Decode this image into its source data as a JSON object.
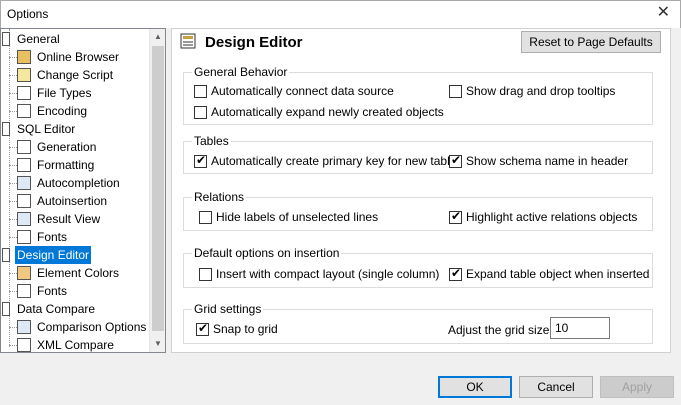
{
  "window": {
    "title": "Options",
    "close_glyph": "✕"
  },
  "tree": {
    "items": [
      {
        "label": "General",
        "icon": "section-icon",
        "level": 0
      },
      {
        "label": "Online Browser",
        "icon": "browser-icon",
        "level": 1
      },
      {
        "label": "Change Script",
        "icon": "script-icon",
        "level": 1
      },
      {
        "label": "File Types",
        "icon": "file-icon",
        "level": 1
      },
      {
        "label": "Encoding",
        "icon": "file-icon",
        "level": 1
      },
      {
        "label": "SQL Editor",
        "icon": "section-icon",
        "level": 0
      },
      {
        "label": "Generation",
        "icon": "gear-icon",
        "level": 1
      },
      {
        "label": "Formatting",
        "icon": "format-icon",
        "level": 1
      },
      {
        "label": "Autocompletion",
        "icon": "list-icon",
        "level": 1
      },
      {
        "label": "Autoinsertion",
        "icon": "insert-icon",
        "level": 1
      },
      {
        "label": "Result View",
        "icon": "grid-icon",
        "level": 1
      },
      {
        "label": "Fonts",
        "icon": "file-icon",
        "level": 1
      },
      {
        "label": "Design Editor",
        "icon": "section-icon",
        "level": 0,
        "selected": true
      },
      {
        "label": "Element Colors",
        "icon": "palette-icon",
        "level": 1
      },
      {
        "label": "Fonts",
        "icon": "file-icon",
        "level": 1
      },
      {
        "label": "Data Compare",
        "icon": "section-icon",
        "level": 0
      },
      {
        "label": "Comparison Options",
        "icon": "compare-icon",
        "level": 1
      },
      {
        "label": "XML Compare",
        "icon": "xml-icon",
        "level": 1
      }
    ]
  },
  "panel": {
    "title": "Design Editor",
    "reset_label": "Reset to Page Defaults",
    "groups": {
      "general": {
        "label": "General Behavior",
        "auto_connect": {
          "label": "Automatically connect data source",
          "checked": false
        },
        "auto_expand": {
          "label": "Automatically expand newly created objects",
          "checked": false
        },
        "drag_tooltips": {
          "label": "Show drag and drop tooltips",
          "checked": false
        }
      },
      "tables": {
        "label": "Tables",
        "auto_pk": {
          "label": "Automatically create primary key for new tables",
          "checked": true
        },
        "schema_header": {
          "label": "Show schema name in header",
          "checked": true
        }
      },
      "relations": {
        "label": "Relations",
        "hide_labels": {
          "label": "Hide labels of unselected lines",
          "checked": false
        },
        "highlight": {
          "label": "Highlight active relations objects",
          "checked": true
        }
      },
      "insertion": {
        "label": "Default options on insertion",
        "compact": {
          "label": "Insert with compact layout (single column)",
          "checked": false
        },
        "expand_table": {
          "label": "Expand table object when inserted",
          "checked": true
        }
      },
      "grid": {
        "label": "Grid settings",
        "snap": {
          "label": "Snap to grid",
          "checked": true
        },
        "size_label": "Adjust the grid size:",
        "size_value": "10"
      }
    }
  },
  "buttons": {
    "ok": "OK",
    "cancel": "Cancel",
    "apply": "Apply"
  },
  "check_glyph": "✔"
}
